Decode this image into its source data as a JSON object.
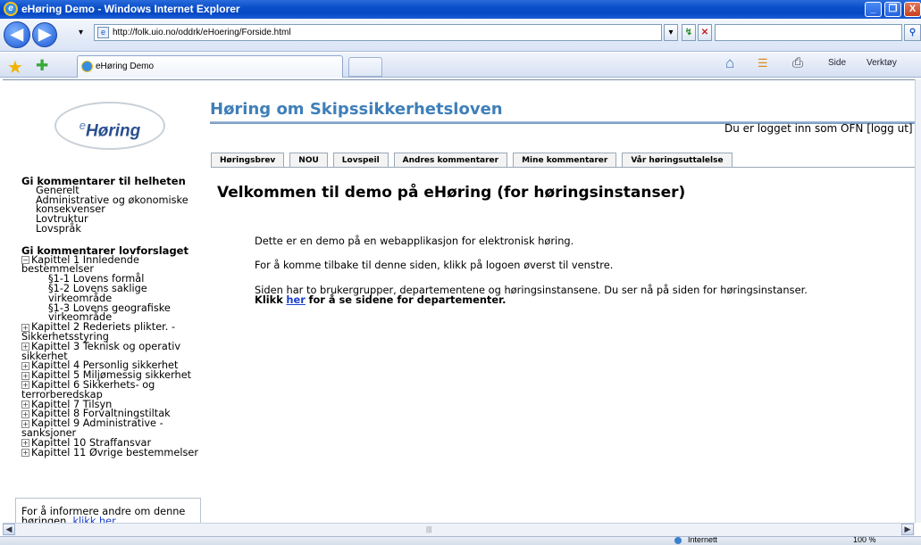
{
  "window": {
    "title": "eHøring Demo - Windows Internet Explorer",
    "minimize_label": "_",
    "restore_label": "❐",
    "close_label": "X"
  },
  "navbar": {
    "back_label": "◀",
    "forward_label": "▶",
    "dropdown_label": "▾",
    "url": "http://folk.uio.no/oddrk/eHoering/Forside.html",
    "refresh_label": "↯",
    "stop_label": "✕",
    "search_placeholder": "",
    "search_go_label": "⚲"
  },
  "tabbar": {
    "tab_label": "eHøring Demo",
    "favorites_label": "★",
    "add_favorites_label": "✚",
    "home_label": "⌂",
    "feeds_label": "☰",
    "print_label": "⎙",
    "page_label": "Side",
    "tools_label": "Verktøy"
  },
  "page": {
    "logo_prefix": "e",
    "logo_text": "Høring",
    "title": "Høring om Skipssikkerhetsloven",
    "logged_in": "Du er logget inn som OFN [logg ut]",
    "tabs": [
      {
        "label": "Høringsbrev"
      },
      {
        "label": "NOU"
      },
      {
        "label": "Lovspeil"
      },
      {
        "label": "Andres kommentarer"
      },
      {
        "label": "Mine kommentarer"
      },
      {
        "label": "Vår høringsuttalelse"
      }
    ],
    "welcome": "Velkommen til demo på eHøring (for høringsinstanser)",
    "para1": "Dette er en demo på en webapplikasjon for elektronisk høring.",
    "para2": "For å komme tilbake til denne siden, klikk på logoen øverst til venstre.",
    "para3": "Siden har to brukergrupper, departementene og høringsinstansene. Du ser nå på siden for høringsinstanser.",
    "para3_bold_a": "Klikk",
    "para3_link": "her",
    "para3_bold_b": "for å se sidene for departementer."
  },
  "sidebar": {
    "heading1": "Gi kommentarer til helheten",
    "general_items": [
      {
        "label": "Generelt"
      },
      {
        "label": "Administrative og økonomiske konsekvenser"
      },
      {
        "label": "Lovtruktur"
      },
      {
        "label": "Lovspråk"
      }
    ],
    "heading2": "Gi kommentarer lovforslaget",
    "chapter1": "Kapittel 1 Innledende bestemmelser",
    "chapter1_items": [
      {
        "label": "§1-1 Lovens formål"
      },
      {
        "label": "§1-2 Lovens saklige virkeområde"
      },
      {
        "label": "§1-3 Lovens geografiske virkeområde"
      }
    ],
    "chapters": [
      {
        "label": "Kapittel 2 Rederiets plikter. - Sikkerhetsstyring"
      },
      {
        "label": "Kapittel 3 Teknisk og operativ sikkerhet"
      },
      {
        "label": "Kapittel 4 Personlig sikkerhet"
      },
      {
        "label": "Kapittel 5 Miljømessig sikkerhet"
      },
      {
        "label": "Kapittel 6 Sikkerhets- og terrorberedskap"
      },
      {
        "label": "Kapittel 7 Tilsyn"
      },
      {
        "label": "Kapittel 8 Forvaltningstiltak"
      },
      {
        "label": "Kapittel 9 Administrative - sanksjoner"
      },
      {
        "label": "Kapittel 10 Straffansvar"
      },
      {
        "label": "Kapittel 11 Øvrige bestemmelser"
      }
    ],
    "info_text": "For å informere andre om denne høringen,",
    "info_link": "klikk her"
  },
  "statusbar": {
    "zone": "Internett",
    "zoom": "100 %"
  }
}
